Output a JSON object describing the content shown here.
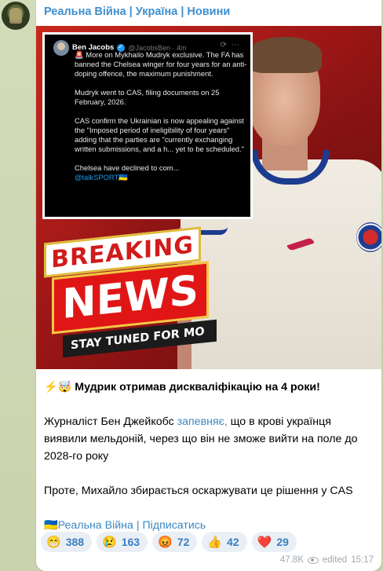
{
  "channel": {
    "title": "Реальна Війна | Україна | Новини"
  },
  "tweet": {
    "author_name": "Ben Jacobs",
    "handle": "@JacobsBen · 4m",
    "paragraphs": [
      "🚨 More on Mykhailo Mudryk exclusive. The FA has banned the Chelsea winger for four years for an anti-doping offence, the maximum punishment.",
      "Mudryk went to CAS, filing documents on 25 February, 2026.",
      "CAS confirm the Ukrainian is now appealing against the \"Imposed period of ineligibility of four years\" adding that the parties are \"currently exchanging written submissions, and a h... yet to be scheduled.\"",
      "Chelsea have declined to com..."
    ],
    "mention": "@talkSPORT🇺🇦"
  },
  "banner": {
    "breaking": "BREAKING",
    "news": "NEWS",
    "stay_tuned": "STAY TUNED FOR MO"
  },
  "message": {
    "headline_emoji": "⚡🤯",
    "headline": "Мудрик отримав дискваліфікацію на 4 роки!",
    "p1_before": "Журналіст Бен Джейкобс ",
    "p1_link": "запевняє,",
    "p1_after": " що в крові українця виявили мельдоній, через що він не зможе вийти на поле до 2028-го року",
    "p2": "Проте, Михайло збирається оскаржувати це рішення у CAS",
    "subscribe_link": "🇺🇦Реальна Війна | Підписатись"
  },
  "reactions": [
    {
      "emoji": "😁",
      "count": "388",
      "icon": "grin-emoji"
    },
    {
      "emoji": "😢",
      "count": "163",
      "icon": "cry-emoji"
    },
    {
      "emoji": "😡",
      "count": "72",
      "icon": "angry-emoji"
    },
    {
      "emoji": "👍",
      "count": "42",
      "icon": "thumbs-up-emoji"
    },
    {
      "emoji": "❤️",
      "count": "29",
      "icon": "heart-emoji"
    }
  ],
  "meta": {
    "views": "47.8K",
    "edited": "edited",
    "time": "15:17"
  }
}
